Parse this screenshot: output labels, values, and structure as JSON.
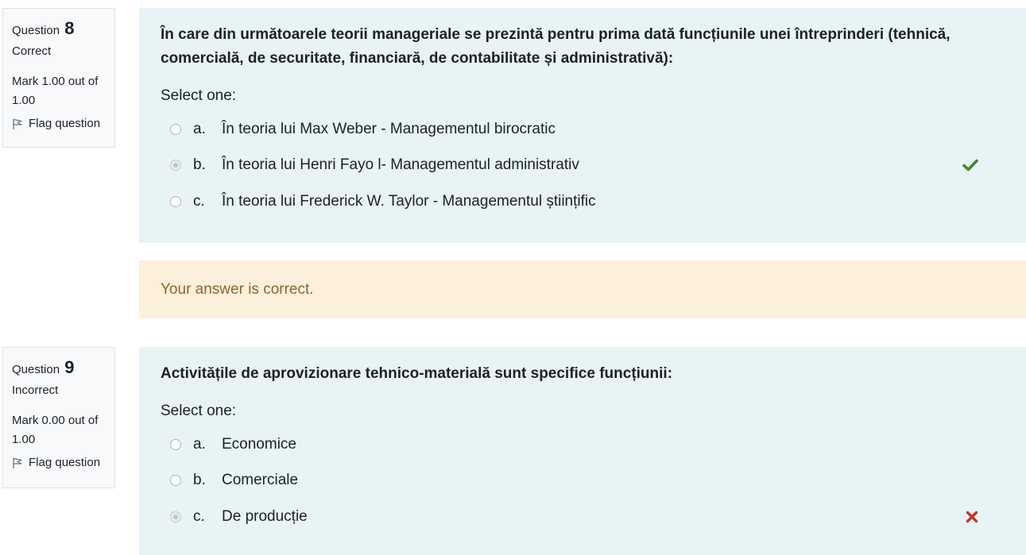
{
  "questions": [
    {
      "label": "Question",
      "number": "8",
      "state": "Correct",
      "mark": "Mark 1.00 out of 1.00",
      "flag_label": "Flag question",
      "text": "În care din următoarele teorii manageriale se prezintă pentru prima dată funcțiunile unei întreprinderi (tehnică, comercială, de securitate, financiară, de contabilitate și administrativă):",
      "prompt": "Select one:",
      "options": [
        {
          "letter": "a.",
          "text": "În teoria lui Max Weber - Managementul birocratic",
          "selected": false
        },
        {
          "letter": "b.",
          "text": "În teoria lui Henri Fayo l- Managementul administrativ",
          "selected": true,
          "icon": "check-icon"
        },
        {
          "letter": "c.",
          "text": "În teoria lui Frederick W. Taylor - Managementul științific",
          "selected": false
        }
      ],
      "feedback": "Your answer is correct."
    },
    {
      "label": "Question",
      "number": "9",
      "state": "Incorrect",
      "mark": "Mark 0.00 out of 1.00",
      "flag_label": "Flag question",
      "text": "Activitățile de aprovizionare tehnico-materială sunt specifice funcțiunii:",
      "prompt": "Select one:",
      "options": [
        {
          "letter": "a.",
          "text": "Economice",
          "selected": false
        },
        {
          "letter": "b.",
          "text": "Comerciale",
          "selected": false
        },
        {
          "letter": "c.",
          "text": "De producție",
          "selected": true,
          "icon": "cross-icon"
        }
      ]
    }
  ],
  "colors": {
    "correct": "#3f8a32",
    "incorrect": "#c0392b",
    "question_bg": "#e7f3f5",
    "feedback_bg": "#fcefdc",
    "feedback_text": "#8e662e"
  }
}
